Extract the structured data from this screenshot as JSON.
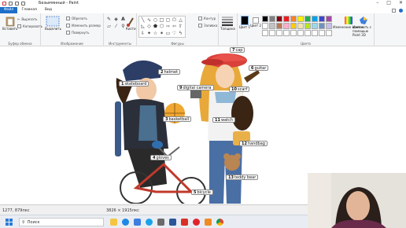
{
  "window": {
    "title": "Безымянный - Paint",
    "controls": [
      "–",
      "□",
      "✕"
    ]
  },
  "tabs": [
    {
      "label": "Файл"
    },
    {
      "label": "Главная"
    },
    {
      "label": "Вид"
    }
  ],
  "ribbon": {
    "clipboard": {
      "paste": "Вставить",
      "cut": "Вырезать",
      "copy": "Копировать",
      "group": "Буфер обмена"
    },
    "image": {
      "select": "Выделить",
      "crop": "Обрезать",
      "resize": "Изменить размер",
      "rotate": "Повернуть",
      "group": "Изображение"
    },
    "tools": {
      "group": "Инструменты",
      "brushes": "Кисти"
    },
    "shapes": {
      "outline": "Контур",
      "fill": "Заливка",
      "group": "Фигуры"
    },
    "size": {
      "label": "Толщина"
    },
    "colors": {
      "color1": "Цвет 1",
      "color2": "Цвет 2",
      "edit": "Изменение цветов",
      "paint3d": "Изменить с помощью Paint 3D",
      "group": "Цвета",
      "palette": [
        "#000000",
        "#7f7f7f",
        "#880015",
        "#ed1c24",
        "#ff7f27",
        "#fff200",
        "#22b14c",
        "#00a2e8",
        "#3f48cc",
        "#a349a4",
        "#ffffff",
        "#c3c3c3",
        "#b97a57",
        "#ffaec9",
        "#ffc90e",
        "#efe4b0",
        "#b5e61d",
        "#99d9ea",
        "#7092be",
        "#c8bfe7",
        "#ffffff",
        "#ffffff",
        "#ffffff",
        "#ffffff",
        "#ffffff",
        "#ffffff",
        "#ffffff",
        "#ffffff",
        "#ffffff",
        "#ffffff"
      ]
    }
  },
  "labels": [
    {
      "num": "1",
      "text": "skateboard"
    },
    {
      "num": "2",
      "text": "helmet"
    },
    {
      "num": "3",
      "text": "basketball"
    },
    {
      "num": "4",
      "text": "gloves"
    },
    {
      "num": "5",
      "text": "bicycle"
    },
    {
      "num": "6",
      "text": "guitar"
    },
    {
      "num": "7",
      "text": "cap"
    },
    {
      "num": "9",
      "text": "digital camera"
    },
    {
      "num": "10",
      "text": "scarf"
    },
    {
      "num": "11",
      "text": "watch"
    },
    {
      "num": "12",
      "text": "handbag"
    },
    {
      "num": "13",
      "text": "teddy bear"
    }
  ],
  "status": {
    "position": "1277, 879пкс",
    "size": "3826 × 1915пкс"
  },
  "taskbar": {
    "search": "Поиск",
    "apps": [
      "file-explorer",
      "edge",
      "mail",
      "skype",
      "store",
      "word",
      "pdf",
      "opera",
      "paint",
      "chrome"
    ]
  }
}
